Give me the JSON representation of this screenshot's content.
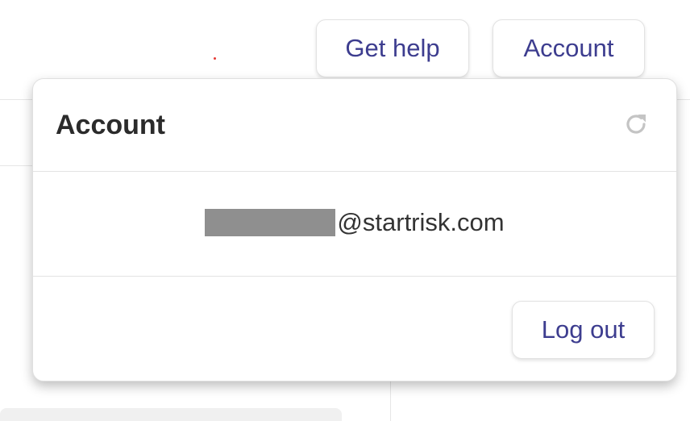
{
  "header": {
    "get_help_label": "Get help",
    "account_label": "Account"
  },
  "account_menu": {
    "title": "Account",
    "refresh_icon": "refresh-icon",
    "email_domain": "@startrisk.com",
    "email_local_redacted": true,
    "logout_label": "Log out"
  },
  "colors": {
    "accent": "#3d3d8f",
    "redaction": "#8f8f8f",
    "title": "#2b2b2b"
  }
}
